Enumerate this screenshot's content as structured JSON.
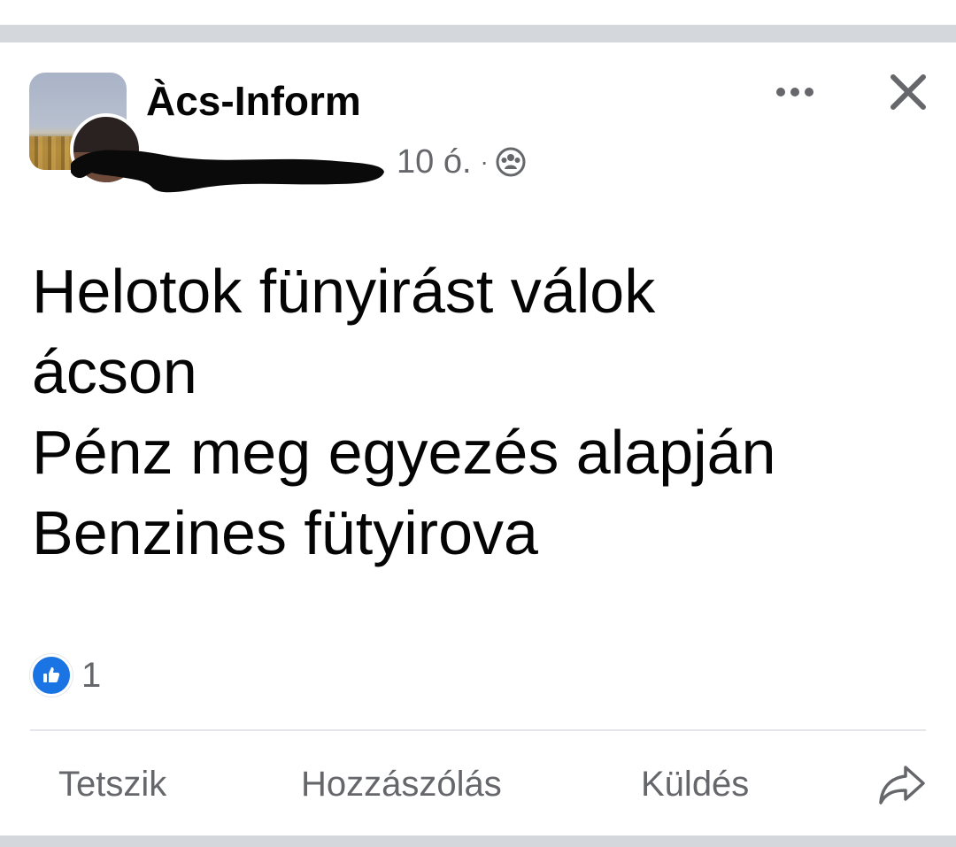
{
  "post": {
    "page_name": "Àcs-Inform",
    "time": "10 ó.",
    "separator": "·",
    "audience_icon": "group-icon",
    "more_icon": "more-horizontal-icon",
    "close_icon": "close-icon",
    "text_lines": [
      "Helotok fünyirást válok",
      "ácson",
      "Pénz meg egyezés alapján",
      "Benzines fütyirova"
    ],
    "reactions": {
      "icon": "like-icon",
      "count": "1"
    }
  },
  "actions": {
    "like_label": "Tetszik",
    "comment_label": "Hozzászólás",
    "send_label": "Küldés",
    "share_icon": "share-icon"
  },
  "colors": {
    "text": "#050505",
    "secondary": "#65676b",
    "like_blue": "#1b74e4",
    "divider": "#d4d7dc"
  }
}
